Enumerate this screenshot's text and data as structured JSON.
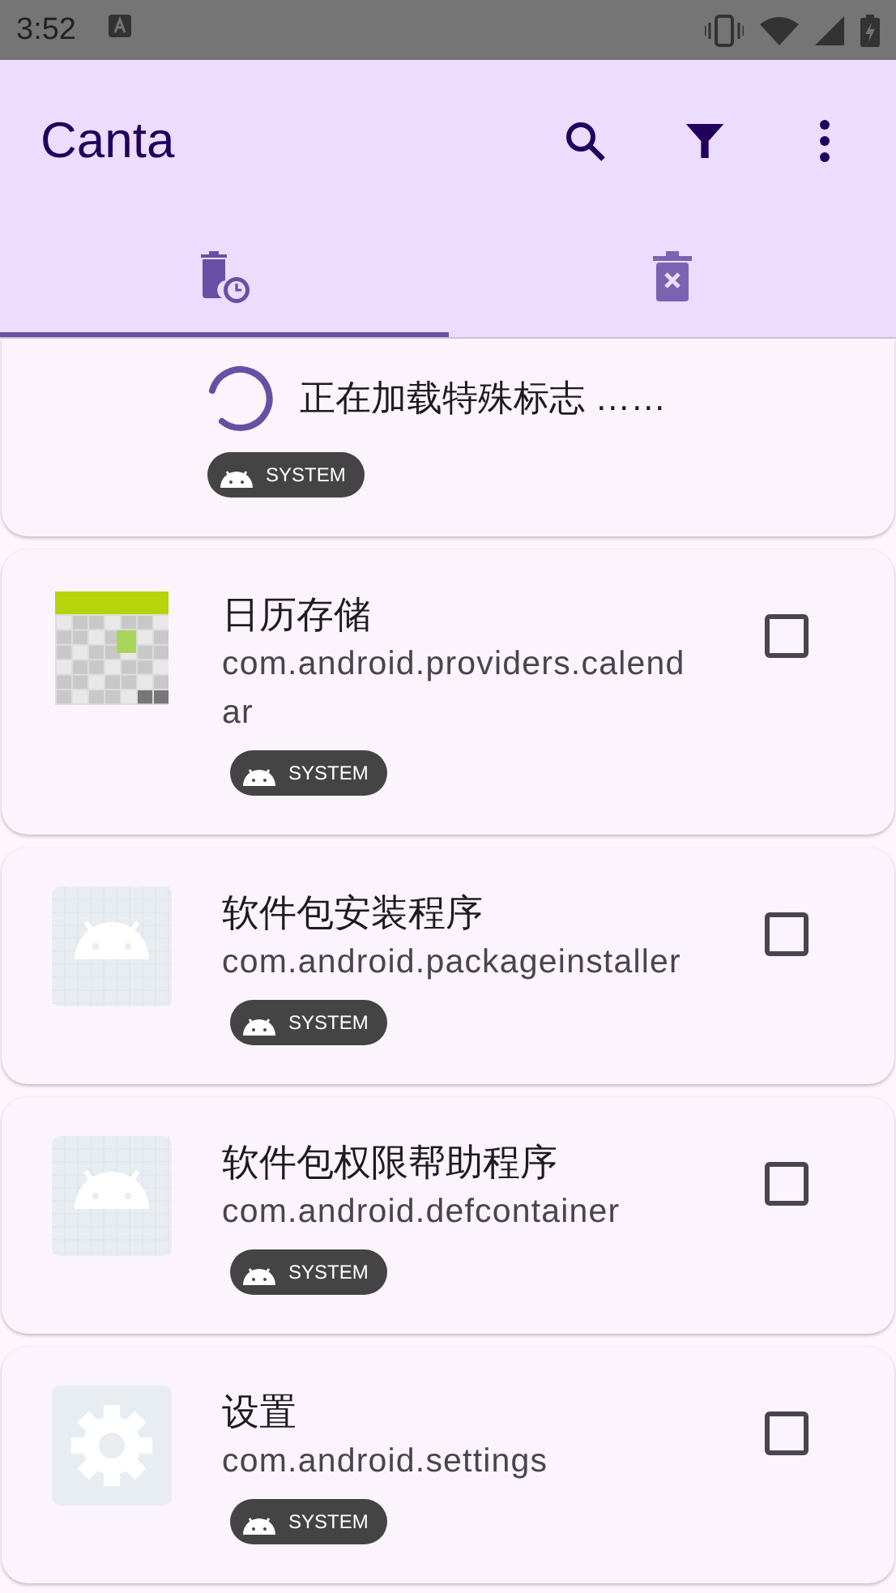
{
  "status_bar": {
    "time": "3:52"
  },
  "app_bar": {
    "title": "Canta"
  },
  "tabs": [
    {
      "kind": "scheduled",
      "selected": true
    },
    {
      "kind": "removed",
      "selected": false
    }
  ],
  "loading": {
    "text": "正在加载特殊标志 ……",
    "badge": "SYSTEM"
  },
  "apps": [
    {
      "kind": "calendar",
      "name": "日历存储",
      "package": "com.android.providers.calendar",
      "badge": "SYSTEM",
      "checked": false
    },
    {
      "kind": "android",
      "name": "软件包安装程序",
      "package": "com.android.packageinstaller",
      "badge": "SYSTEM",
      "checked": false
    },
    {
      "kind": "android",
      "name": "软件包权限帮助程序",
      "package": "com.android.defcontainer",
      "badge": "SYSTEM",
      "checked": false
    },
    {
      "kind": "settings",
      "name": "设置",
      "package": "com.android.settings",
      "badge": "SYSTEM",
      "checked": false
    }
  ]
}
